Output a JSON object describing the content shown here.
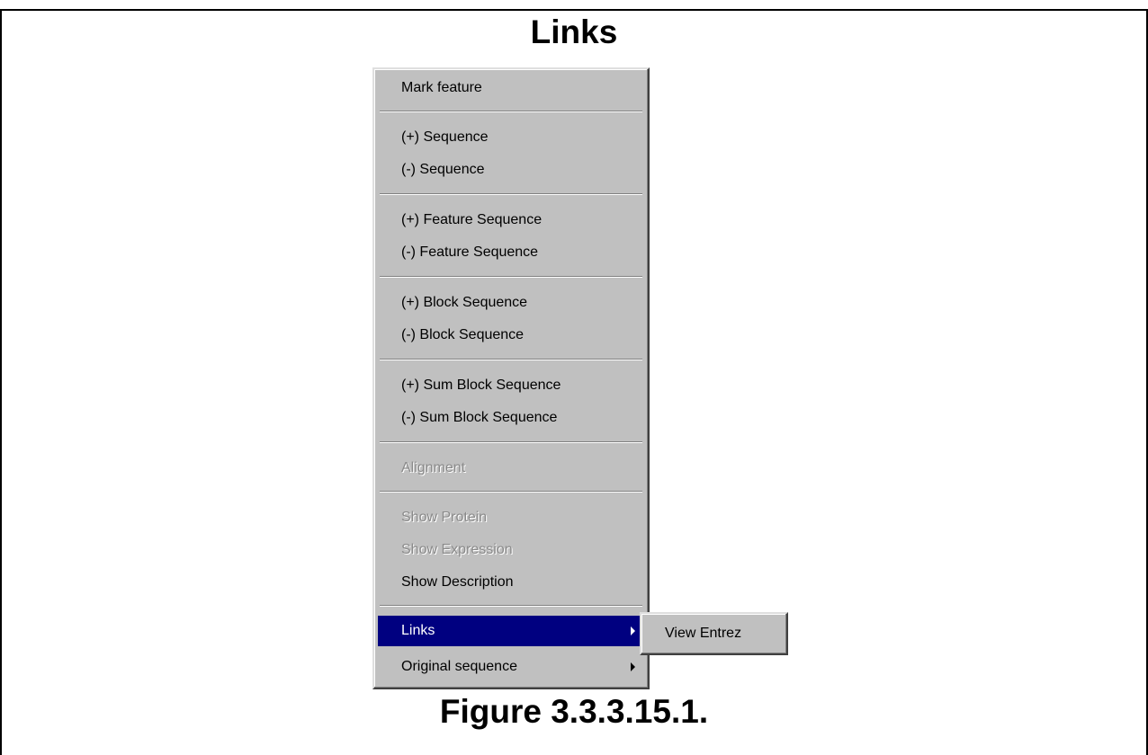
{
  "page": {
    "title": "Links",
    "caption": "Figure 3.3.3.15.1."
  },
  "menu": {
    "items": [
      {
        "label": "Mark feature",
        "enabled": true
      },
      {
        "label": "(+) Sequence",
        "enabled": true
      },
      {
        "label": "(-) Sequence",
        "enabled": true
      },
      {
        "label": "(+) Feature Sequence",
        "enabled": true
      },
      {
        "label": "(-) Feature Sequence",
        "enabled": true
      },
      {
        "label": "(+) Block Sequence",
        "enabled": true
      },
      {
        "label": "(-) Block Sequence",
        "enabled": true
      },
      {
        "label": "(+) Sum Block Sequence",
        "enabled": true
      },
      {
        "label": "(-) Sum Block Sequence",
        "enabled": true
      },
      {
        "label": "Alignment",
        "enabled": false
      },
      {
        "label": "Show Protein",
        "enabled": false
      },
      {
        "label": "Show Expression",
        "enabled": false
      },
      {
        "label": "Show Description",
        "enabled": true
      },
      {
        "label": "Links",
        "enabled": true,
        "selected": true,
        "has_submenu": true
      },
      {
        "label": "Original sequence",
        "enabled": true,
        "has_submenu": true
      }
    ],
    "selected_color": "#000080"
  },
  "submenu": {
    "items": [
      {
        "label": "View Entrez"
      }
    ]
  }
}
